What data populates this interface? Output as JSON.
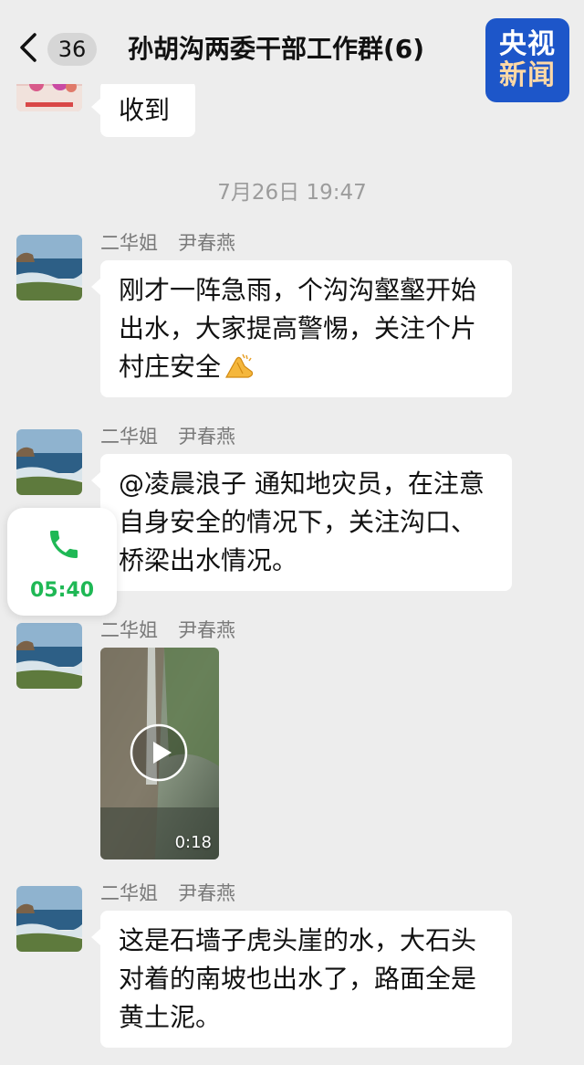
{
  "header": {
    "unread_count": "36",
    "title": "孙胡沟两委干部工作群(6)"
  },
  "logo": {
    "line1": "央视",
    "line2": "新闻"
  },
  "first_message": {
    "text": "收到"
  },
  "timestamp": "7月26日 19:47",
  "messages": [
    {
      "sender_nickname": "二华姐",
      "sender_name": "尹春燕",
      "text": "刚才一阵急雨，个沟沟壑壑开始出水，大家提高警惕，关注个片村庄安全",
      "emoji": "folded-hands-emoji"
    },
    {
      "sender_nickname": "二华姐",
      "sender_name": "尹春燕",
      "text": "@凌晨浪子 通知地灾员，在注意自身安全的情况下，关注沟口、桥梁出水情况。"
    },
    {
      "sender_nickname": "二华姐",
      "sender_name": "尹春燕",
      "video_duration": "0:18"
    },
    {
      "sender_nickname": "二华姐",
      "sender_name": "尹春燕",
      "text": "这是石墙子虎头崖的水，大石头对着的南坡也出水了，路面全是黄土泥。"
    }
  ],
  "call": {
    "icon": "phone-icon",
    "duration": "05:40",
    "color": "#1fb855"
  },
  "colors": {
    "background": "#ededed",
    "bubble": "#ffffff",
    "logo": "#1d56c9"
  }
}
